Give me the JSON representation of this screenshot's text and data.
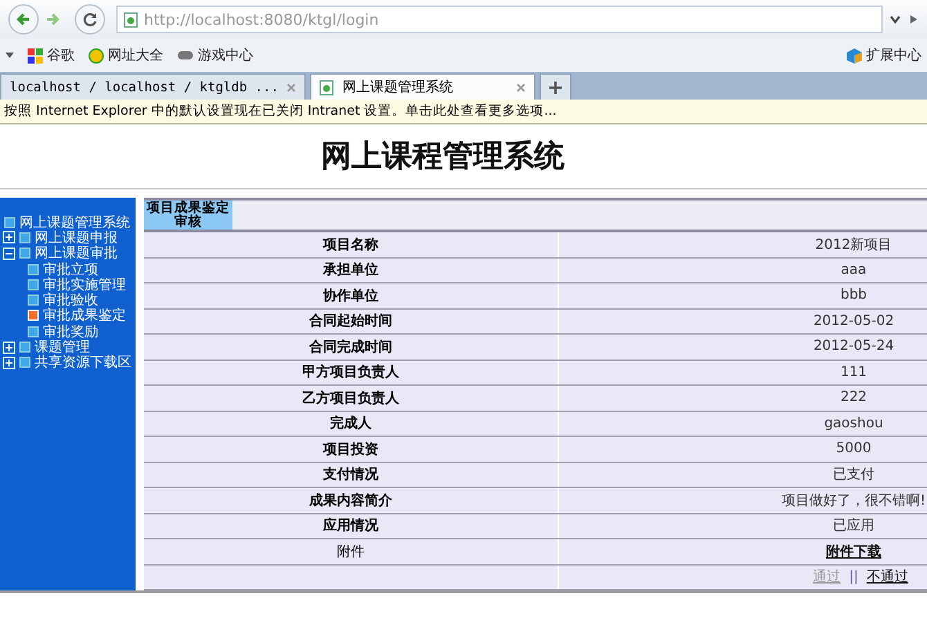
{
  "browser": {
    "address": "http://localhost:8080/ktgl/login",
    "bookmarks": [
      {
        "label": "谷歌",
        "kind": "google"
      },
      {
        "label": "网址大全",
        "kind": "globe"
      },
      {
        "label": "游戏中心",
        "kind": "game"
      }
    ],
    "extensions": "扩展中心",
    "tabs": [
      {
        "label": "localhost / localhost / ktgldb ...",
        "selected": false
      },
      {
        "label": "网上课题管理系统",
        "selected": true
      }
    ],
    "info_bar": "按照 Internet Explorer 中的默认设置现在已关闭 Intranet 设置。单击此处查看更多选项..."
  },
  "page": {
    "title": "网上课程管理系统",
    "sidebar": {
      "items": [
        {
          "label": "网上课题管理系统",
          "selected": false
        },
        {
          "label": "网上课题申报",
          "selected": false,
          "expanded": false
        },
        {
          "label": "网上课题审批",
          "selected": false,
          "expanded": true,
          "children": [
            {
              "label": "审批立项",
              "selected": false
            },
            {
              "label": "审批实施管理",
              "selected": false
            },
            {
              "label": "审批验收",
              "selected": false
            },
            {
              "label": "审批成果鉴定",
              "selected": true
            },
            {
              "label": "审批奖励",
              "selected": false
            }
          ]
        },
        {
          "label": "课题管理",
          "selected": false,
          "expanded": false
        },
        {
          "label": "共享资源下载区",
          "selected": false,
          "expanded": false
        }
      ]
    },
    "panel_tab": "项目成果鉴定审核",
    "rows": [
      {
        "label": "项目名称",
        "value": "2012新项目"
      },
      {
        "label": "承担单位",
        "value": "aaa"
      },
      {
        "label": "协作单位",
        "value": "bbb"
      },
      {
        "label": "合同起始时间",
        "value": "2012-05-02"
      },
      {
        "label": "合同完成时间",
        "value": "2012-05-24"
      },
      {
        "label": "甲方项目负责人",
        "value": "111"
      },
      {
        "label": "乙方项目负责人",
        "value": "222"
      },
      {
        "label": "完成人",
        "value": "gaoshou"
      },
      {
        "label": "项目投资",
        "value": "5000"
      },
      {
        "label": "支付情况",
        "value": "已支付"
      },
      {
        "label": "成果内容简介",
        "value": "项目做好了，很不错啊!"
      },
      {
        "label": "应用情况",
        "value": "已应用"
      },
      {
        "label": "附件",
        "kind": "link",
        "value": "附件下载"
      }
    ],
    "actions": {
      "approve": {
        "label": "通过",
        "disabled": true
      },
      "separator": "||",
      "reject": {
        "label": "不通过",
        "disabled": false
      }
    }
  }
}
